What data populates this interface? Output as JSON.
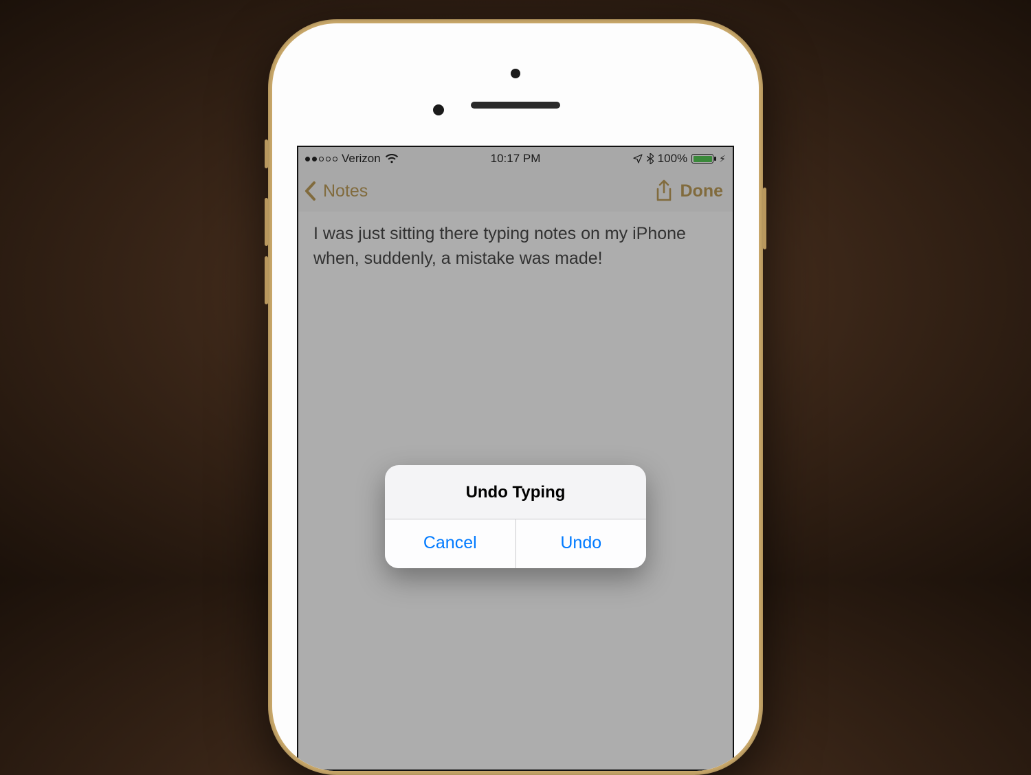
{
  "status": {
    "carrier": "Verizon",
    "time": "10:17 PM",
    "battery_percent": "100%"
  },
  "nav": {
    "back_label": "Notes",
    "done_label": "Done"
  },
  "note": {
    "text": "I was just sitting there typing notes on my iPhone when, suddenly, a mistake was made!"
  },
  "alert": {
    "title": "Undo Typing",
    "cancel_label": "Cancel",
    "undo_label": "Undo"
  },
  "colors": {
    "accent_gold": "#b38e3f",
    "ios_blue": "#007aff",
    "battery_green": "#3ac23a"
  }
}
